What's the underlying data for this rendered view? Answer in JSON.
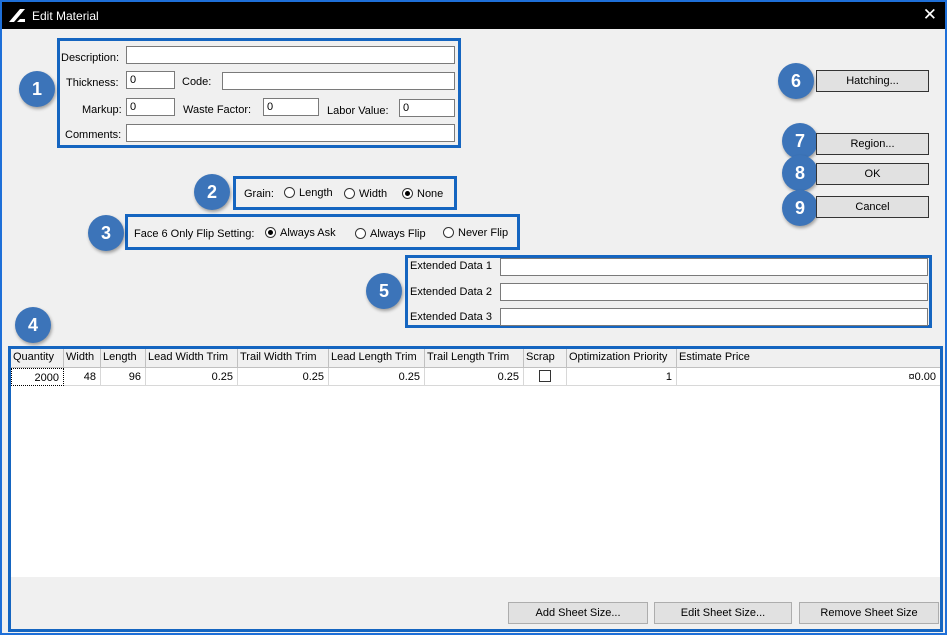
{
  "window": {
    "title": "Edit Material",
    "close_label": "✕"
  },
  "badges": [
    "1",
    "2",
    "3",
    "4",
    "5",
    "6",
    "7",
    "8",
    "9"
  ],
  "fields": {
    "description_label": "Description:",
    "description_value": "",
    "thickness_label": "Thickness:",
    "thickness_value": "0",
    "code_label": "Code:",
    "code_value": "",
    "markup_label": "Markup:",
    "markup_value": "0",
    "waste_label": "Waste Factor:",
    "waste_value": "0",
    "labor_label": "Labor Value:",
    "labor_value": "0",
    "comments_label": "Comments:",
    "comments_value": ""
  },
  "grain": {
    "label": "Grain:",
    "options": [
      "Length",
      "Width",
      "None"
    ],
    "selected": "None"
  },
  "face6": {
    "label": "Face 6 Only Flip Setting:",
    "options": [
      "Always Ask",
      "Always Flip",
      "Never Flip"
    ],
    "selected": "Always Ask"
  },
  "extended": {
    "labels": [
      "Extended Data 1",
      "Extended Data 2",
      "Extended Data 3"
    ],
    "values": [
      "",
      "",
      ""
    ]
  },
  "buttons": {
    "hatching": "Hatching...",
    "region": "Region...",
    "ok": "OK",
    "cancel": "Cancel"
  },
  "grid": {
    "columns": [
      "Quantity",
      "Width",
      "Length",
      "Lead Width Trim",
      "Trail Width Trim",
      "Lead Length Trim",
      "Trail Length Trim",
      "Scrap",
      "Optimization Priority",
      "Estimate Price"
    ],
    "rows": [
      {
        "quantity": "2000",
        "width": "48",
        "length": "96",
        "lead_width_trim": "0.25",
        "trail_width_trim": "0.25",
        "lead_length_trim": "0.25",
        "trail_length_trim": "0.25",
        "scrap": false,
        "priority": "1",
        "price": "¤0.00"
      }
    ]
  },
  "sheet_buttons": {
    "add": "Add Sheet Size...",
    "edit": "Edit Sheet Size...",
    "remove": "Remove Sheet Size"
  },
  "colors": {
    "highlight": "#1565c0",
    "badge": "#3c74b9",
    "titlebar": "#000000",
    "window_border": "#1e6fd8"
  }
}
